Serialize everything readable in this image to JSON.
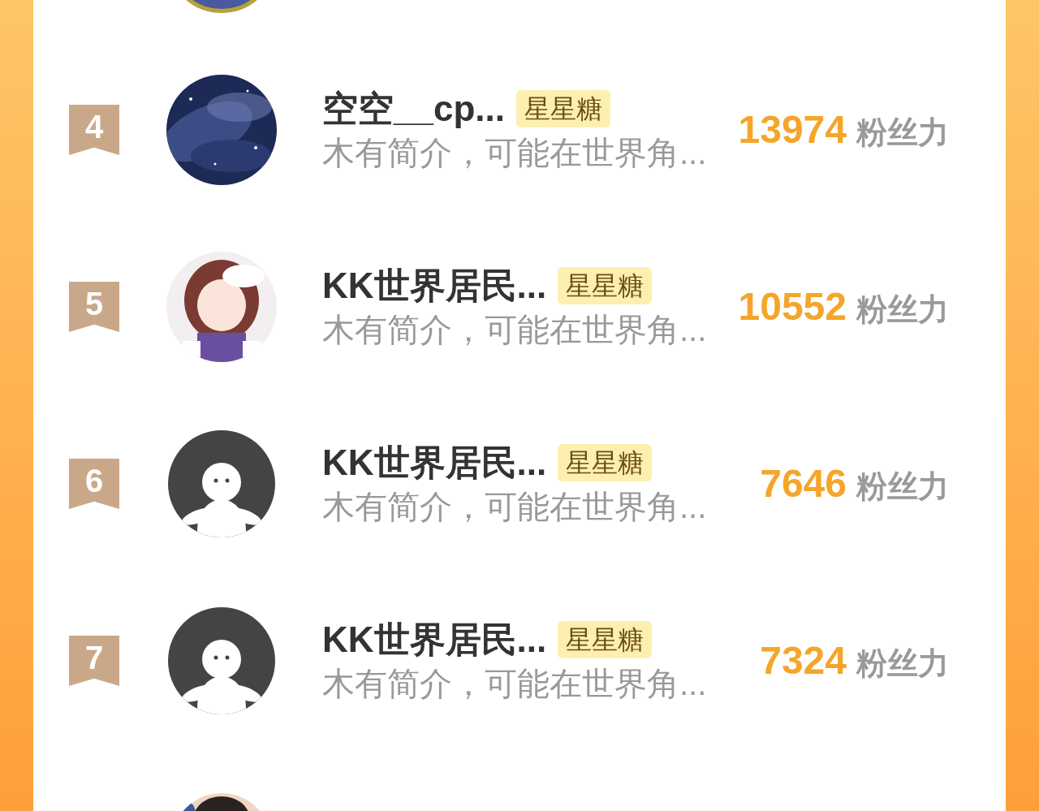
{
  "rows": [
    {
      "rank": "4",
      "avatar": {
        "kind": "stars"
      },
      "name": "空空__cp...",
      "badge": "星星糖",
      "bio": "木有简介，可能在世界角...",
      "score": "13974",
      "score_unit": "粉丝力"
    },
    {
      "rank": "5",
      "name": "KK世界居民...",
      "badge": "星星糖",
      "bio": "木有简介，可能在世界角...",
      "score": "10552",
      "score_unit": "粉丝力"
    },
    {
      "rank": "6",
      "avatar": {
        "kind": "default"
      },
      "name": "KK世界居民...",
      "badge": "星星糖",
      "bio": "木有简介，可能在世界角...",
      "score": "7646",
      "score_unit": "粉丝力"
    },
    {
      "rank": "7",
      "avatar": {
        "kind": "default"
      },
      "name": "KK世界居民...",
      "badge": "星星糖",
      "bio": "木有简介，可能在世界角...",
      "score": "7324",
      "score_unit": "粉丝力"
    }
  ]
}
